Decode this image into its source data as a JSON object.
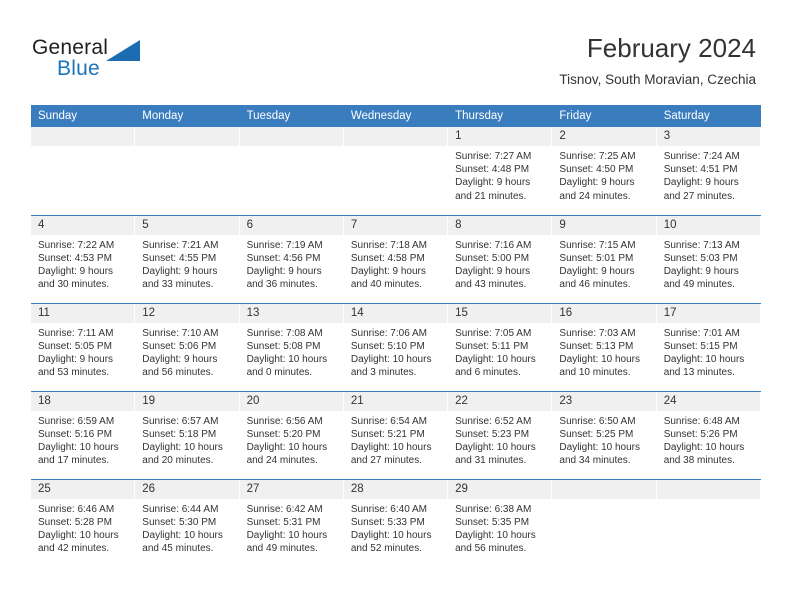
{
  "brand": {
    "name_part1": "General",
    "name_part2": "Blue",
    "accent_color": "#1b75bb"
  },
  "header": {
    "title": "February 2024",
    "subtitle": "Tisnov, South Moravian, Czechia"
  },
  "calendar": {
    "header_bg": "#3a7dbf",
    "daynum_bg": "#f0f0f0",
    "weekday_headers": [
      "Sunday",
      "Monday",
      "Tuesday",
      "Wednesday",
      "Thursday",
      "Friday",
      "Saturday"
    ],
    "weeks": [
      [
        {
          "day": "",
          "lines": []
        },
        {
          "day": "",
          "lines": []
        },
        {
          "day": "",
          "lines": []
        },
        {
          "day": "",
          "lines": []
        },
        {
          "day": "1",
          "lines": [
            "Sunrise: 7:27 AM",
            "Sunset: 4:48 PM",
            "Daylight: 9 hours",
            "and 21 minutes."
          ]
        },
        {
          "day": "2",
          "lines": [
            "Sunrise: 7:25 AM",
            "Sunset: 4:50 PM",
            "Daylight: 9 hours",
            "and 24 minutes."
          ]
        },
        {
          "day": "3",
          "lines": [
            "Sunrise: 7:24 AM",
            "Sunset: 4:51 PM",
            "Daylight: 9 hours",
            "and 27 minutes."
          ]
        }
      ],
      [
        {
          "day": "4",
          "lines": [
            "Sunrise: 7:22 AM",
            "Sunset: 4:53 PM",
            "Daylight: 9 hours",
            "and 30 minutes."
          ]
        },
        {
          "day": "5",
          "lines": [
            "Sunrise: 7:21 AM",
            "Sunset: 4:55 PM",
            "Daylight: 9 hours",
            "and 33 minutes."
          ]
        },
        {
          "day": "6",
          "lines": [
            "Sunrise: 7:19 AM",
            "Sunset: 4:56 PM",
            "Daylight: 9 hours",
            "and 36 minutes."
          ]
        },
        {
          "day": "7",
          "lines": [
            "Sunrise: 7:18 AM",
            "Sunset: 4:58 PM",
            "Daylight: 9 hours",
            "and 40 minutes."
          ]
        },
        {
          "day": "8",
          "lines": [
            "Sunrise: 7:16 AM",
            "Sunset: 5:00 PM",
            "Daylight: 9 hours",
            "and 43 minutes."
          ]
        },
        {
          "day": "9",
          "lines": [
            "Sunrise: 7:15 AM",
            "Sunset: 5:01 PM",
            "Daylight: 9 hours",
            "and 46 minutes."
          ]
        },
        {
          "day": "10",
          "lines": [
            "Sunrise: 7:13 AM",
            "Sunset: 5:03 PM",
            "Daylight: 9 hours",
            "and 49 minutes."
          ]
        }
      ],
      [
        {
          "day": "11",
          "lines": [
            "Sunrise: 7:11 AM",
            "Sunset: 5:05 PM",
            "Daylight: 9 hours",
            "and 53 minutes."
          ]
        },
        {
          "day": "12",
          "lines": [
            "Sunrise: 7:10 AM",
            "Sunset: 5:06 PM",
            "Daylight: 9 hours",
            "and 56 minutes."
          ]
        },
        {
          "day": "13",
          "lines": [
            "Sunrise: 7:08 AM",
            "Sunset: 5:08 PM",
            "Daylight: 10 hours",
            "and 0 minutes."
          ]
        },
        {
          "day": "14",
          "lines": [
            "Sunrise: 7:06 AM",
            "Sunset: 5:10 PM",
            "Daylight: 10 hours",
            "and 3 minutes."
          ]
        },
        {
          "day": "15",
          "lines": [
            "Sunrise: 7:05 AM",
            "Sunset: 5:11 PM",
            "Daylight: 10 hours",
            "and 6 minutes."
          ]
        },
        {
          "day": "16",
          "lines": [
            "Sunrise: 7:03 AM",
            "Sunset: 5:13 PM",
            "Daylight: 10 hours",
            "and 10 minutes."
          ]
        },
        {
          "day": "17",
          "lines": [
            "Sunrise: 7:01 AM",
            "Sunset: 5:15 PM",
            "Daylight: 10 hours",
            "and 13 minutes."
          ]
        }
      ],
      [
        {
          "day": "18",
          "lines": [
            "Sunrise: 6:59 AM",
            "Sunset: 5:16 PM",
            "Daylight: 10 hours",
            "and 17 minutes."
          ]
        },
        {
          "day": "19",
          "lines": [
            "Sunrise: 6:57 AM",
            "Sunset: 5:18 PM",
            "Daylight: 10 hours",
            "and 20 minutes."
          ]
        },
        {
          "day": "20",
          "lines": [
            "Sunrise: 6:56 AM",
            "Sunset: 5:20 PM",
            "Daylight: 10 hours",
            "and 24 minutes."
          ]
        },
        {
          "day": "21",
          "lines": [
            "Sunrise: 6:54 AM",
            "Sunset: 5:21 PM",
            "Daylight: 10 hours",
            "and 27 minutes."
          ]
        },
        {
          "day": "22",
          "lines": [
            "Sunrise: 6:52 AM",
            "Sunset: 5:23 PM",
            "Daylight: 10 hours",
            "and 31 minutes."
          ]
        },
        {
          "day": "23",
          "lines": [
            "Sunrise: 6:50 AM",
            "Sunset: 5:25 PM",
            "Daylight: 10 hours",
            "and 34 minutes."
          ]
        },
        {
          "day": "24",
          "lines": [
            "Sunrise: 6:48 AM",
            "Sunset: 5:26 PM",
            "Daylight: 10 hours",
            "and 38 minutes."
          ]
        }
      ],
      [
        {
          "day": "25",
          "lines": [
            "Sunrise: 6:46 AM",
            "Sunset: 5:28 PM",
            "Daylight: 10 hours",
            "and 42 minutes."
          ]
        },
        {
          "day": "26",
          "lines": [
            "Sunrise: 6:44 AM",
            "Sunset: 5:30 PM",
            "Daylight: 10 hours",
            "and 45 minutes."
          ]
        },
        {
          "day": "27",
          "lines": [
            "Sunrise: 6:42 AM",
            "Sunset: 5:31 PM",
            "Daylight: 10 hours",
            "and 49 minutes."
          ]
        },
        {
          "day": "28",
          "lines": [
            "Sunrise: 6:40 AM",
            "Sunset: 5:33 PM",
            "Daylight: 10 hours",
            "and 52 minutes."
          ]
        },
        {
          "day": "29",
          "lines": [
            "Sunrise: 6:38 AM",
            "Sunset: 5:35 PM",
            "Daylight: 10 hours",
            "and 56 minutes."
          ]
        },
        {
          "day": "",
          "lines": []
        },
        {
          "day": "",
          "lines": []
        }
      ]
    ]
  }
}
